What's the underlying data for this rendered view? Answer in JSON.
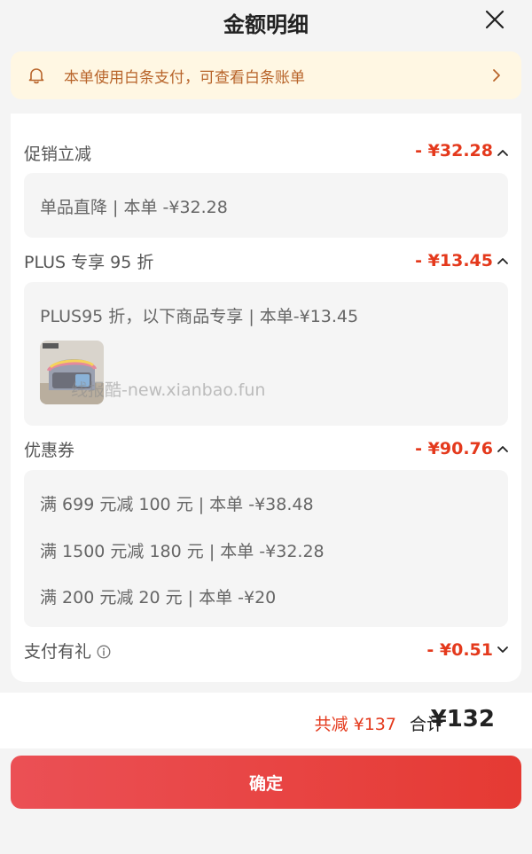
{
  "header": {
    "title": "金额明细"
  },
  "banner": {
    "text": "本单使用白条支付，可查看白条账单"
  },
  "watermark": "线报酷-new.xianbao.fun",
  "sections": [
    {
      "label": "促销立减",
      "amount": "- ¥32.28",
      "lines": [
        "单品直降 | 本单 -¥32.28"
      ]
    },
    {
      "label": "PLUS 专享 95 折",
      "amount": "- ¥13.45",
      "lines": [
        "PLUS95 折，以下商品专享 | 本单-¥13.45"
      ]
    },
    {
      "label": "优惠券",
      "amount": "- ¥90.76",
      "lines": [
        "满 699 元减 100 元 | 本单 -¥38.48",
        "满 1500 元减 180 元 | 本单 -¥32.28",
        "满 200 元减 20 元 | 本单 -¥20"
      ]
    },
    {
      "label": "支付有礼",
      "amount": "- ¥0.51"
    }
  ],
  "summary": {
    "saved": "共减 ¥137",
    "total_label": "合计",
    "total_value": "¥132"
  },
  "confirm_label": "确定"
}
